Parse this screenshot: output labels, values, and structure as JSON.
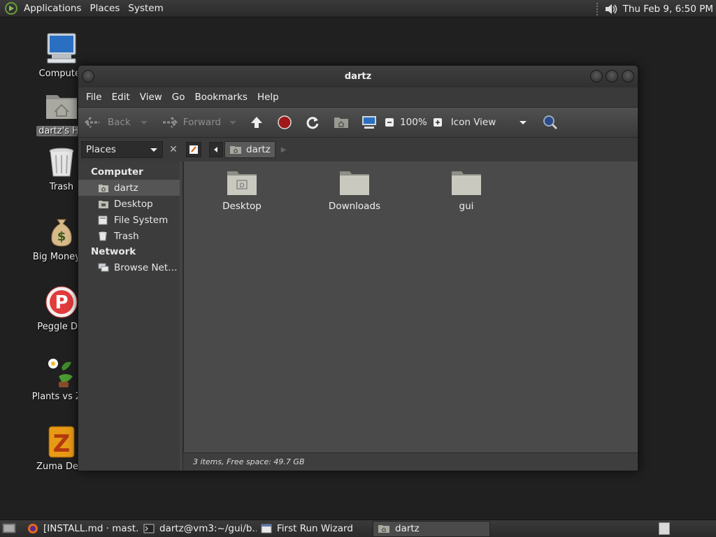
{
  "top_panel": {
    "menus": [
      "Applications",
      "Places",
      "System"
    ],
    "clock": "Thu Feb  9,  6:50 PM"
  },
  "desktop_icons": [
    {
      "label": "Computer",
      "icon": "computer-icon"
    },
    {
      "label": "dartz's Ho",
      "icon": "home-folder-icon",
      "selected": true
    },
    {
      "label": "Trash",
      "icon": "trash-icon"
    },
    {
      "label": "Big Money D",
      "icon": "big-money-icon"
    },
    {
      "label": "Peggle Del",
      "icon": "peggle-icon"
    },
    {
      "label": "Plants vs Zor",
      "icon": "plants-vs-zombies-icon"
    },
    {
      "label": "Zuma Delu",
      "icon": "zuma-icon"
    }
  ],
  "window": {
    "title": "dartz",
    "menus": [
      "File",
      "Edit",
      "View",
      "Go",
      "Bookmarks",
      "Help"
    ],
    "toolbar": {
      "back": "Back",
      "forward": "Forward",
      "zoom": "100%",
      "view_mode": "Icon View"
    },
    "location": {
      "sidebar_mode": "Places",
      "crumb": "dartz"
    },
    "sidebar": {
      "computer_header": "Computer",
      "computer_items": [
        {
          "label": "dartz",
          "icon": "home-icon",
          "selected": true
        },
        {
          "label": "Desktop",
          "icon": "desktop-icon"
        },
        {
          "label": "File System",
          "icon": "drive-icon"
        },
        {
          "label": "Trash",
          "icon": "trash-icon"
        }
      ],
      "network_header": "Network",
      "network_items": [
        {
          "label": "Browse Net…",
          "icon": "network-icon"
        }
      ]
    },
    "files": [
      {
        "name": "Desktop",
        "icon": "desktop-folder-icon"
      },
      {
        "name": "Downloads",
        "icon": "folder-icon"
      },
      {
        "name": "gui",
        "icon": "folder-icon"
      }
    ],
    "status": "3 items, Free space: 49.7 GB"
  },
  "taskbar": {
    "tasks": [
      {
        "label": "[INSTALL.md · mast…",
        "icon": "firefox-icon"
      },
      {
        "label": "dartz@vm3:~/gui/b…",
        "icon": "terminal-icon"
      },
      {
        "label": "First Run Wizard",
        "icon": "window-icon"
      },
      {
        "label": "dartz",
        "icon": "home-folder-icon",
        "active": true
      }
    ]
  }
}
